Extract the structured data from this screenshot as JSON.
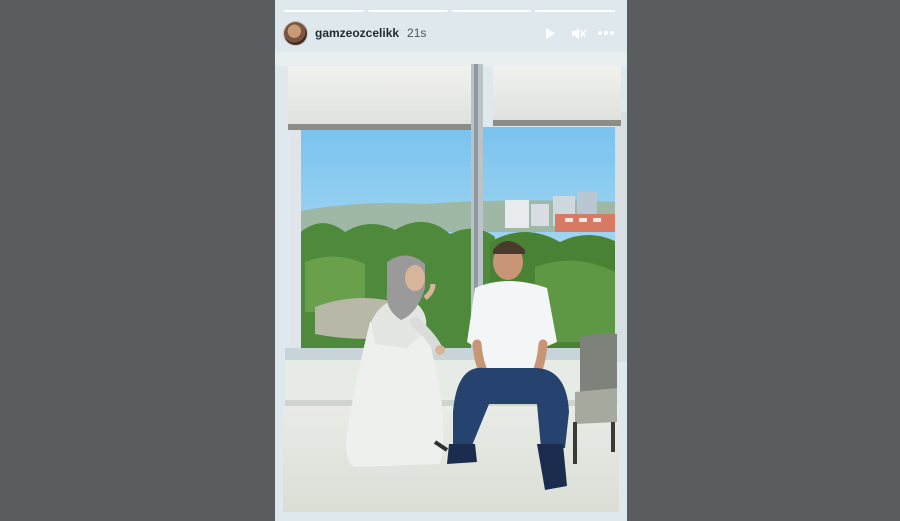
{
  "story": {
    "username": "gamzeozcelikk",
    "time_ago": "21s",
    "progress_segments": 4,
    "active_segment": 0
  },
  "icons": {
    "play": "play-icon",
    "mute": "speaker-muted-icon",
    "more": "more-options-icon"
  },
  "colors": {
    "page_background": "#5a5d5f",
    "story_background": "#dfe8ec",
    "sky": "#7fc7ee"
  }
}
